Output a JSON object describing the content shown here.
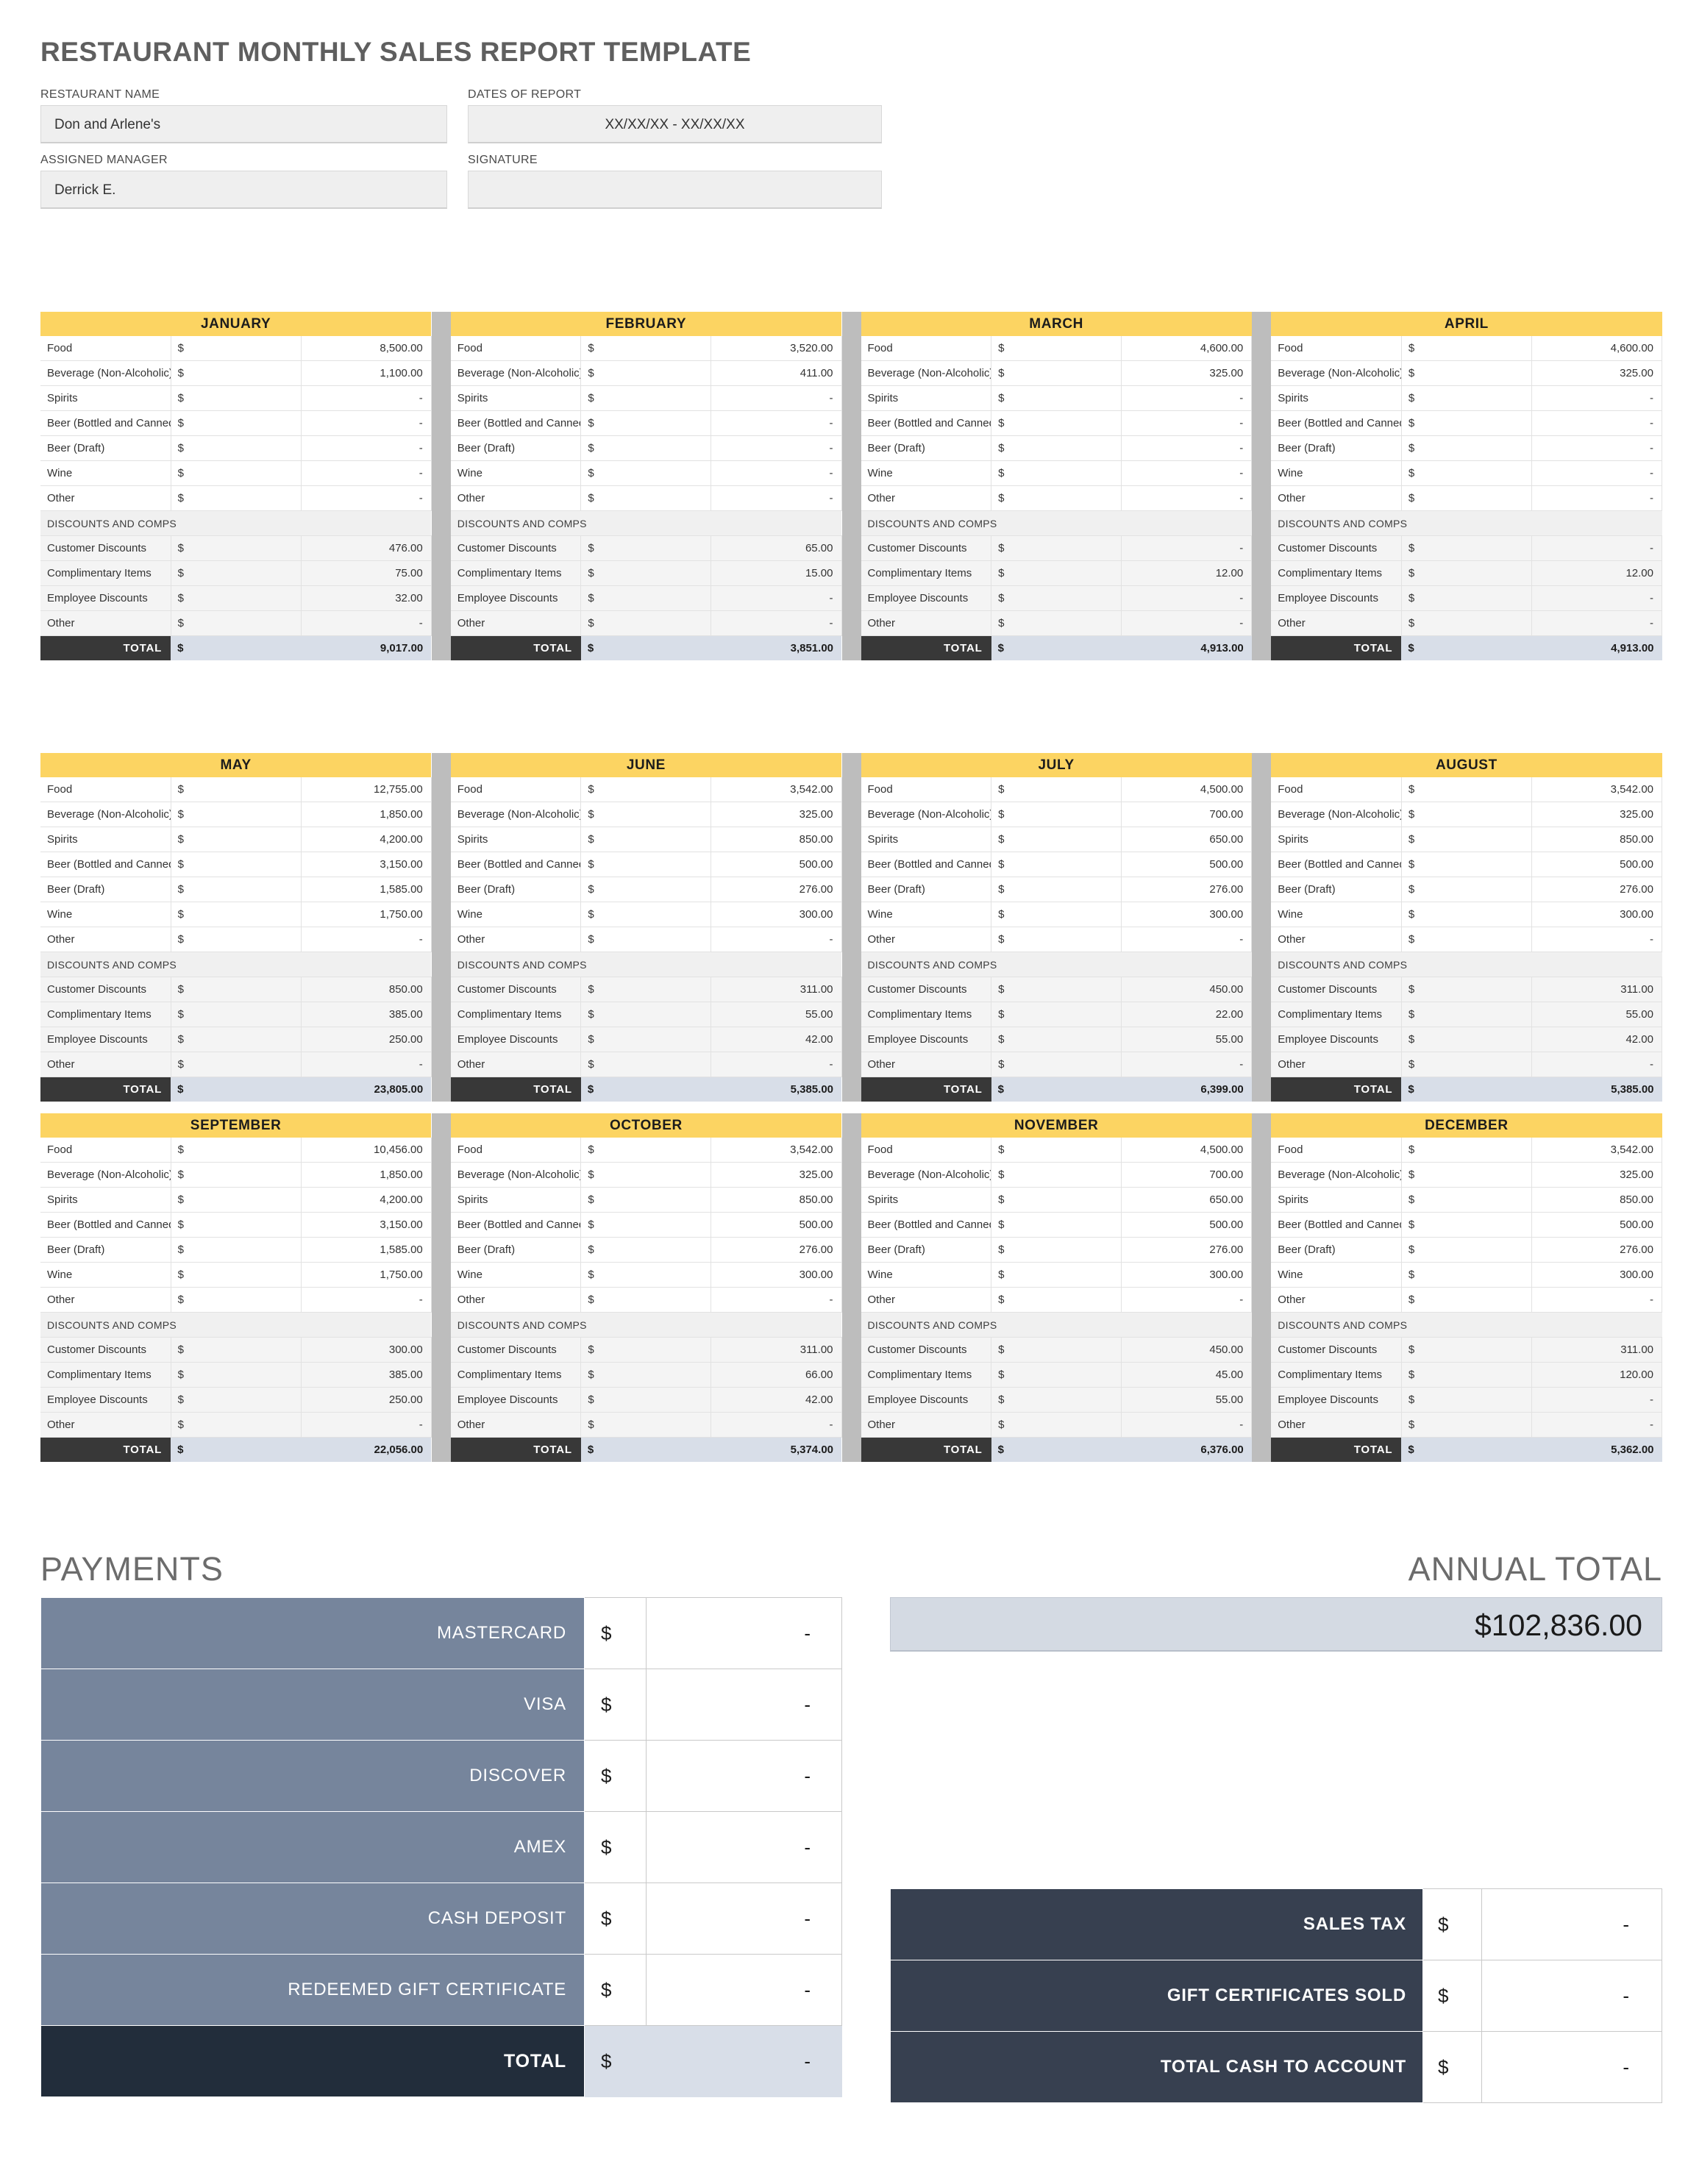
{
  "document": {
    "title": "RESTAURANT MONTHLY SALES REPORT TEMPLATE"
  },
  "meta": {
    "restaurant_name_label": "RESTAURANT NAME",
    "restaurant_name_value": "Don and Arlene's",
    "dates_label": "DATES OF REPORT",
    "dates_value": "XX/XX/XX - XX/XX/XX",
    "manager_label": "ASSIGNED MANAGER",
    "manager_value": "Derrick E.",
    "signature_label": "SIGNATURE",
    "signature_value": ""
  },
  "row_labels": {
    "food": "Food",
    "beverage": "Beverage (Non-Alcoholic)",
    "spirits": "Spirits",
    "beer_bottled": "Beer (Bottled and Canned)",
    "beer_draft": "Beer (Draft)",
    "wine": "Wine",
    "other_sales": "Other",
    "discounts_header": "DISCOUNTS AND COMPS",
    "customer_discounts": "Customer Discounts",
    "complimentary_items": "Complimentary Items",
    "employee_discounts": "Employee Discounts",
    "other_discounts": "Other",
    "total": "TOTAL",
    "currency": "$"
  },
  "months": [
    {
      "name": "JANUARY",
      "food": "8,500.00",
      "beverage": "1,100.00",
      "spirits": "-",
      "beer_bottled": "-",
      "beer_draft": "-",
      "wine": "-",
      "other_sales": "-",
      "customer_discounts": "476.00",
      "complimentary_items": "75.00",
      "employee_discounts": "32.00",
      "other_discounts": "-",
      "total": "9,017.00"
    },
    {
      "name": "FEBRUARY",
      "food": "3,520.00",
      "beverage": "411.00",
      "spirits": "-",
      "beer_bottled": "-",
      "beer_draft": "-",
      "wine": "-",
      "other_sales": "-",
      "customer_discounts": "65.00",
      "complimentary_items": "15.00",
      "employee_discounts": "-",
      "other_discounts": "-",
      "total": "3,851.00"
    },
    {
      "name": "MARCH",
      "food": "4,600.00",
      "beverage": "325.00",
      "spirits": "-",
      "beer_bottled": "-",
      "beer_draft": "-",
      "wine": "-",
      "other_sales": "-",
      "customer_discounts": "-",
      "complimentary_items": "12.00",
      "employee_discounts": "-",
      "other_discounts": "-",
      "total": "4,913.00"
    },
    {
      "name": "APRIL",
      "food": "4,600.00",
      "beverage": "325.00",
      "spirits": "-",
      "beer_bottled": "-",
      "beer_draft": "-",
      "wine": "-",
      "other_sales": "-",
      "customer_discounts": "-",
      "complimentary_items": "12.00",
      "employee_discounts": "-",
      "other_discounts": "-",
      "total": "4,913.00"
    },
    {
      "name": "MAY",
      "food": "12,755.00",
      "beverage": "1,850.00",
      "spirits": "4,200.00",
      "beer_bottled": "3,150.00",
      "beer_draft": "1,585.00",
      "wine": "1,750.00",
      "other_sales": "-",
      "customer_discounts": "850.00",
      "complimentary_items": "385.00",
      "employee_discounts": "250.00",
      "other_discounts": "-",
      "total": "23,805.00"
    },
    {
      "name": "JUNE",
      "food": "3,542.00",
      "beverage": "325.00",
      "spirits": "850.00",
      "beer_bottled": "500.00",
      "beer_draft": "276.00",
      "wine": "300.00",
      "other_sales": "-",
      "customer_discounts": "311.00",
      "complimentary_items": "55.00",
      "employee_discounts": "42.00",
      "other_discounts": "-",
      "total": "5,385.00"
    },
    {
      "name": "JULY",
      "food": "4,500.00",
      "beverage": "700.00",
      "spirits": "650.00",
      "beer_bottled": "500.00",
      "beer_draft": "276.00",
      "wine": "300.00",
      "other_sales": "-",
      "customer_discounts": "450.00",
      "complimentary_items": "22.00",
      "employee_discounts": "55.00",
      "other_discounts": "-",
      "total": "6,399.00"
    },
    {
      "name": "AUGUST",
      "food": "3,542.00",
      "beverage": "325.00",
      "spirits": "850.00",
      "beer_bottled": "500.00",
      "beer_draft": "276.00",
      "wine": "300.00",
      "other_sales": "-",
      "customer_discounts": "311.00",
      "complimentary_items": "55.00",
      "employee_discounts": "42.00",
      "other_discounts": "-",
      "total": "5,385.00"
    },
    {
      "name": "SEPTEMBER",
      "food": "10,456.00",
      "beverage": "1,850.00",
      "spirits": "4,200.00",
      "beer_bottled": "3,150.00",
      "beer_draft": "1,585.00",
      "wine": "1,750.00",
      "other_sales": "-",
      "customer_discounts": "300.00",
      "complimentary_items": "385.00",
      "employee_discounts": "250.00",
      "other_discounts": "-",
      "total": "22,056.00"
    },
    {
      "name": "OCTOBER",
      "food": "3,542.00",
      "beverage": "325.00",
      "spirits": "850.00",
      "beer_bottled": "500.00",
      "beer_draft": "276.00",
      "wine": "300.00",
      "other_sales": "-",
      "customer_discounts": "311.00",
      "complimentary_items": "66.00",
      "employee_discounts": "42.00",
      "other_discounts": "-",
      "total": "5,374.00"
    },
    {
      "name": "NOVEMBER",
      "food": "4,500.00",
      "beverage": "700.00",
      "spirits": "650.00",
      "beer_bottled": "500.00",
      "beer_draft": "276.00",
      "wine": "300.00",
      "other_sales": "-",
      "customer_discounts": "450.00",
      "complimentary_items": "45.00",
      "employee_discounts": "55.00",
      "other_discounts": "-",
      "total": "6,376.00"
    },
    {
      "name": "DECEMBER",
      "food": "3,542.00",
      "beverage": "325.00",
      "spirits": "850.00",
      "beer_bottled": "500.00",
      "beer_draft": "276.00",
      "wine": "300.00",
      "other_sales": "-",
      "customer_discounts": "311.00",
      "complimentary_items": "120.00",
      "employee_discounts": "-",
      "other_discounts": "-",
      "total": "5,362.00"
    }
  ],
  "payments": {
    "heading": "PAYMENTS",
    "currency": "$",
    "rows": [
      {
        "label": "MASTERCARD",
        "value": "-"
      },
      {
        "label": "VISA",
        "value": "-"
      },
      {
        "label": "DISCOVER",
        "value": "-"
      },
      {
        "label": "AMEX",
        "value": "-"
      },
      {
        "label": "CASH DEPOSIT",
        "value": "-"
      },
      {
        "label": "REDEEMED GIFT CERTIFICATE",
        "value": "-"
      }
    ],
    "total_label": "TOTAL",
    "total_value": "-"
  },
  "annual": {
    "heading": "ANNUAL TOTAL",
    "value": "$102,836.00",
    "currency": "$",
    "rows": [
      {
        "label": "SALES TAX",
        "value": "-"
      },
      {
        "label": "GIFT CERTIFICATES SOLD",
        "value": "-"
      },
      {
        "label": "TOTAL CASH TO ACCOUNT",
        "value": "-"
      }
    ]
  },
  "colors": {
    "month_header": "#fcd462",
    "total_bar": "#383838",
    "total_value_bg": "#d8dee8",
    "payments_label_bg": "#76859c",
    "payments_total_bg": "#222d3b",
    "summary_label_bg": "#374050",
    "annual_box_bg": "#d4dae3",
    "separator": "#bdbdbd"
  }
}
